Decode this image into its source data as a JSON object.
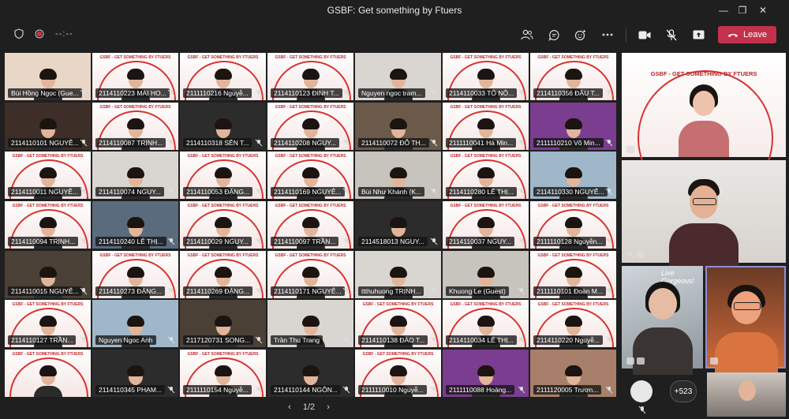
{
  "window": {
    "title": "GSBF: Get something by Ftuers"
  },
  "toolbar": {
    "timer": "--:--",
    "leave_label": "Leave"
  },
  "branding": {
    "banner": "GSBF - GET SOMETHING BY FTUERS",
    "live_text": "Live Gorgeous!"
  },
  "grid": [
    "Bùi Hồng Ngọc (Gue...",
    "2114110223  MAI HO...",
    "2111110216  Nguyễ...",
    "2114110123  ĐINH T...",
    "Nguyen ngoc tram...",
    "2114110033  TÔ NỘ...",
    "2114110356  ĐẬU T...",
    "2114110101  NGUYỄ...",
    "2114110087  TRỊNH...",
    "2114110318  SÊN T...",
    "2114110208  NGUY...",
    "2114110072  ĐỖ TH...",
    "2111110041  Hà Min...",
    "2111110210  Võ Min...",
    "2114110011  NGUYỄ...",
    "2114110074  NGUY...",
    "2114110053  ĐẶNG...",
    "2114110169  NGUYỄ...",
    "Bùi Như Khánh (K...",
    "2114110280  LÊ THỊ...",
    "2114110330  NGUYỄ...",
    "2114110094  TRỊNH...",
    "2114110240  LÊ THỊ...",
    "2114110029  NGUY...",
    "2114110097  TRẦN...",
    "2114518013  NGUY...",
    "2114110037  NGUY...",
    "2111110128  Nguyễn...",
    "2114110015  NGUYỄ...",
    "2114110273  ĐẶNG...",
    "2114110269  ĐẶNG...",
    "2114110171  NGUYỄ...",
    "ttthuhuong TRỊNH...",
    "Khuong Le (Guest)",
    "2111110101  Đoàn M...",
    "2114110127  TRẦN...",
    "Nguyen Ngoc Anh",
    "2117120731  SONG...",
    "Trần Thu Trang",
    "2114110138  ĐÀO T...",
    "2114110034  LÊ THỊ...",
    "2114110220  Nguyễ...",
    "",
    "2114110345  PHẠM...",
    "2111110154  Nguyễ...",
    "2114110144  NGÔN...",
    "2111110010  Nguyễ...",
    "2111110088  Hoàng...",
    "2111120005  Trươn..."
  ],
  "pager": {
    "label": "1/2"
  },
  "overflow": {
    "count": "+523"
  },
  "icons": {
    "people": "people-icon",
    "chat": "chat-icon",
    "react": "react-icon",
    "more": "more-icon",
    "camera": "camera-icon",
    "mic": "mic-off-icon",
    "share": "share-icon",
    "phone": "phone-icon"
  },
  "colors": {
    "leave": "#c4314b",
    "accent": "#d8332f"
  }
}
